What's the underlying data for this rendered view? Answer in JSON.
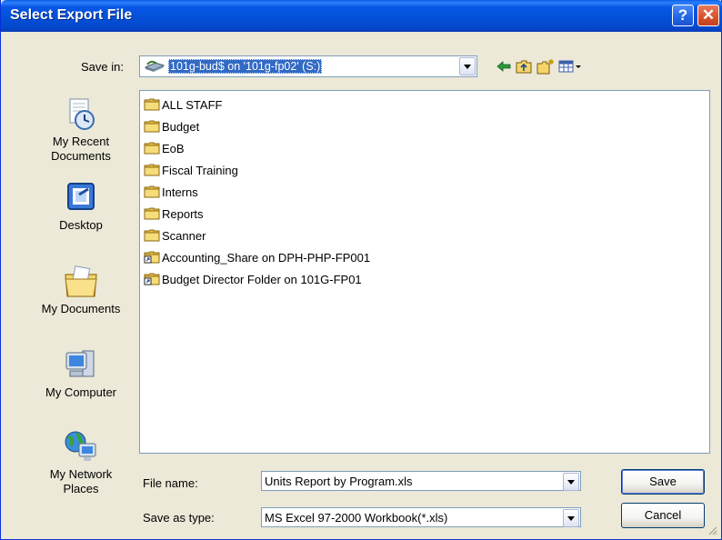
{
  "window": {
    "title": "Select Export File"
  },
  "titlebar": {
    "help_glyph": "?",
    "close_glyph": "✕"
  },
  "savein": {
    "label": "Save in:",
    "value": "101g-bud$ on '101g-fp02' (S:)"
  },
  "toolbar": {
    "icons": [
      "back-icon",
      "up-folder-icon",
      "new-folder-icon",
      "view-menu-icon"
    ]
  },
  "places": [
    {
      "label": "My Recent Documents",
      "icon": "recent-documents-icon"
    },
    {
      "label": "Desktop",
      "icon": "desktop-icon"
    },
    {
      "label": "My Documents",
      "icon": "my-documents-icon"
    },
    {
      "label": "My Computer",
      "icon": "my-computer-icon"
    },
    {
      "label": "My Network Places",
      "icon": "network-places-icon"
    }
  ],
  "files": [
    {
      "name": "ALL STAFF",
      "type": "folder"
    },
    {
      "name": "Budget",
      "type": "folder"
    },
    {
      "name": "EoB",
      "type": "folder"
    },
    {
      "name": "Fiscal Training",
      "type": "folder"
    },
    {
      "name": "Interns",
      "type": "folder"
    },
    {
      "name": "Reports",
      "type": "folder"
    },
    {
      "name": "Scanner",
      "type": "folder"
    },
    {
      "name": "Accounting_Share on DPH-PHP-FP001",
      "type": "shortcut"
    },
    {
      "name": "Budget Director Folder on 101G-FP01",
      "type": "shortcut"
    }
  ],
  "filename": {
    "label": "File name:",
    "value": "Units Report by Program.xls"
  },
  "filetype": {
    "label": "Save as type:",
    "value": "MS Excel 97-2000 Workbook(*.xls)"
  },
  "buttons": {
    "save": "Save",
    "cancel": "Cancel"
  },
  "colors": {
    "titlebar": "#0450d9",
    "selection": "#316ac5",
    "folder": "#f5d46a"
  }
}
